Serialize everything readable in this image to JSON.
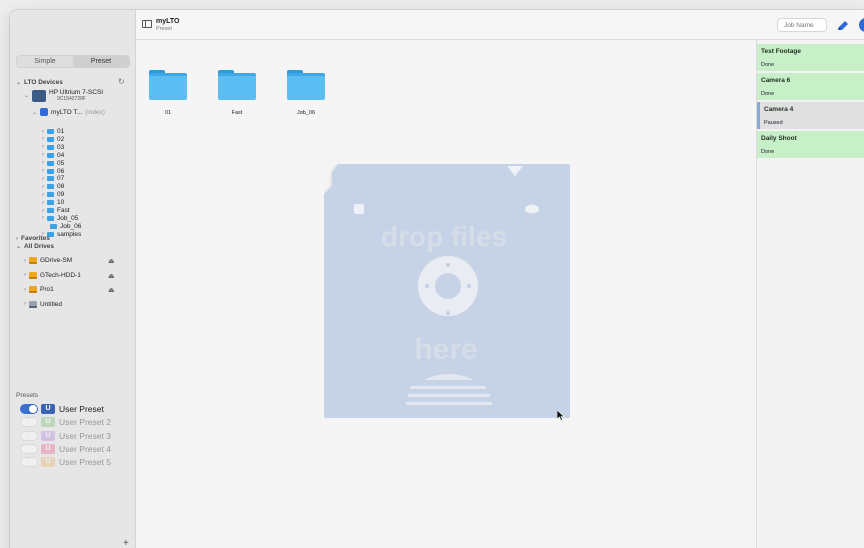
{
  "app": {
    "title": "myLTO",
    "subtitle": "Preset"
  },
  "toolbar": {
    "job_name_placeholder": "Job Name"
  },
  "sidebar": {
    "tabs": [
      "Simple",
      "Preset"
    ],
    "lto_devices_label": "LTO Devices",
    "device": {
      "name": "HP Ultrium 7-SCSI",
      "serial": "9C1542728F"
    },
    "tape": {
      "name": "myLTO T...",
      "note": "(index)"
    },
    "tape_folders": [
      "01",
      "02",
      "03",
      "04",
      "05",
      "06",
      "07",
      "08",
      "09",
      "10",
      "Fast",
      "Job_05",
      "Job_06",
      "samples"
    ],
    "favorites_label": "Favorites",
    "all_drives_label": "All Drives",
    "drives": [
      {
        "name": "GDrive-SM",
        "ejectable": true
      },
      {
        "name": "GTech-HDD-1",
        "ejectable": true
      },
      {
        "name": "Pro1",
        "ejectable": true
      },
      {
        "name": "Untitled",
        "ejectable": false
      }
    ],
    "presets_label": "Presets",
    "presets": [
      {
        "badge": "U",
        "name": "User Preset",
        "enabled": true,
        "color": "#3b63b3"
      },
      {
        "badge": "U",
        "name": "User Preset 2",
        "enabled": false,
        "color": "#7ec27f"
      },
      {
        "badge": "U",
        "name": "User Preset 3",
        "enabled": false,
        "color": "#b48de0"
      },
      {
        "badge": "U",
        "name": "User Preset 4",
        "enabled": false,
        "color": "#e86b8f"
      },
      {
        "badge": "U",
        "name": "User Preset 5",
        "enabled": false,
        "color": "#e7b574"
      }
    ]
  },
  "content": {
    "folders": [
      "01",
      "Fast",
      "Job_06"
    ],
    "drop_zone": {
      "line1": "drop files",
      "line2": "here"
    }
  },
  "jobs": [
    {
      "name": "Test Footage",
      "status": "Done"
    },
    {
      "name": "Camera 6",
      "status": "Done"
    },
    {
      "name": "Camera 4",
      "status": "Paused"
    },
    {
      "name": "Daily Shoot",
      "status": "Done"
    }
  ],
  "colors": {
    "accent": "#2f6bd8",
    "done": "#c7efc8",
    "paused": "#e0e0e0",
    "folder": "#5cbdf3"
  }
}
